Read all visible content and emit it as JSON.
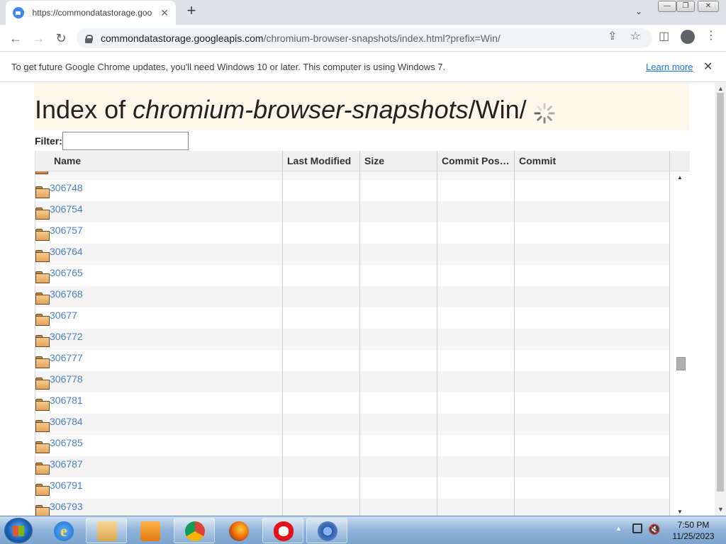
{
  "tab": {
    "title": "https://commondatastorage.goo",
    "close": "✕",
    "new_tab": "+"
  },
  "window_controls": {
    "minimize": "—",
    "restore": "❐",
    "close": "✕"
  },
  "toolbar": {
    "back": "←",
    "forward": "→",
    "reload": "↻",
    "url_host": "commondatastorage.googleapis.com",
    "url_path": "/chromium-browser-snapshots/index.html?prefix=Win/"
  },
  "infobar": {
    "message": "To get future Google Chrome updates, you'll need Windows 10 or later. This computer is using Windows 7.",
    "learn_more": "Learn more",
    "close": "✕"
  },
  "page": {
    "title_prefix": "Index of ",
    "title_bucket": "chromium-browser-snapshots",
    "title_suffix": "/Win/",
    "filter_label": "Filter:",
    "filter_value": ""
  },
  "grid": {
    "columns": [
      "Name",
      "Last Modified",
      "Size",
      "Commit Pos…",
      "Commit"
    ],
    "rows": [
      "306748",
      "306754",
      "306757",
      "306764",
      "306765",
      "306768",
      "30677",
      "306772",
      "306777",
      "306778",
      "306781",
      "306784",
      "306785",
      "306787",
      "306791",
      "306793"
    ]
  },
  "taskbar": {
    "apps": [
      "explorer-folder",
      "internet-explorer",
      "media-player",
      "chrome",
      "firefox",
      "opera",
      "chromium"
    ],
    "time": "7:50 PM",
    "date": "11/25/2023"
  },
  "colors": {
    "link": "#4a7fc1",
    "header_band": "#fff7ea",
    "infobar_link": "#1a73e8"
  }
}
